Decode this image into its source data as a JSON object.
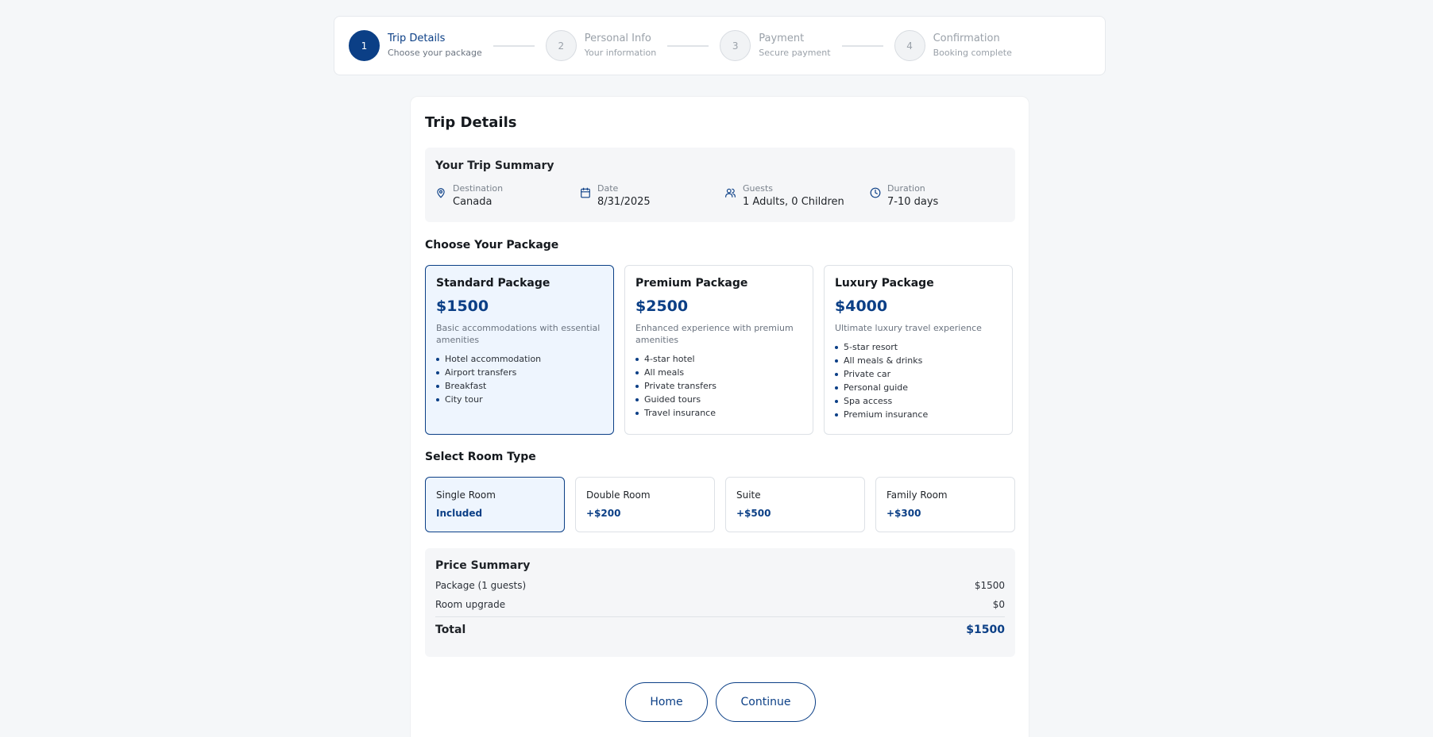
{
  "stepper": {
    "steps": [
      {
        "number": "1",
        "title": "Trip Details",
        "subtitle": "Choose your package"
      },
      {
        "number": "2",
        "title": "Personal Info",
        "subtitle": "Your information"
      },
      {
        "number": "3",
        "title": "Payment",
        "subtitle": "Secure payment"
      },
      {
        "number": "4",
        "title": "Confirmation",
        "subtitle": "Booking complete"
      }
    ],
    "active_step": 1
  },
  "page_title": "Trip Details",
  "summary": {
    "title": "Your Trip Summary",
    "items": [
      {
        "icon": "location-pin-icon",
        "label": "Destination",
        "value": "Canada"
      },
      {
        "icon": "calendar-icon",
        "label": "Date",
        "value": "8/31/2025"
      },
      {
        "icon": "users-icon",
        "label": "Guests",
        "value": "1 Adults, 0 Children"
      },
      {
        "icon": "clock-icon",
        "label": "Duration",
        "value": "7-10 days"
      }
    ]
  },
  "packages": {
    "title": "Choose Your Package",
    "selected": "Standard Package",
    "items": [
      {
        "name": "Standard Package",
        "price": "$1500",
        "description": "Basic accommodations with essential amenities",
        "features": [
          "Hotel accommodation",
          "Airport transfers",
          "Breakfast",
          "City tour"
        ]
      },
      {
        "name": "Premium Package",
        "price": "$2500",
        "description": "Enhanced experience with premium amenities",
        "features": [
          "4-star hotel",
          "All meals",
          "Private transfers",
          "Guided tours",
          "Travel insurance"
        ]
      },
      {
        "name": "Luxury Package",
        "price": "$4000",
        "description": "Ultimate luxury travel experience",
        "features": [
          "5-star resort",
          "All meals & drinks",
          "Private car",
          "Personal guide",
          "Spa access",
          "Premium insurance"
        ]
      }
    ]
  },
  "rooms": {
    "title": "Select Room Type",
    "selected": "Single Room",
    "items": [
      {
        "name": "Single Room",
        "price": "Included"
      },
      {
        "name": "Double Room",
        "price": "+$200"
      },
      {
        "name": "Suite",
        "price": "+$500"
      },
      {
        "name": "Family Room",
        "price": "+$300"
      }
    ]
  },
  "price_summary": {
    "title": "Price Summary",
    "rows": [
      {
        "label": "Package (1 guests)",
        "value": "$1500"
      },
      {
        "label": "Room upgrade",
        "value": "$0"
      }
    ],
    "total_label": "Total",
    "total_value": "$1500"
  },
  "buttons": {
    "home": "Home",
    "continue": "Continue"
  },
  "colors": {
    "accent": "#0b3f86",
    "selected_bg": "#eef5fe",
    "page_bg": "#f5f7f9"
  }
}
